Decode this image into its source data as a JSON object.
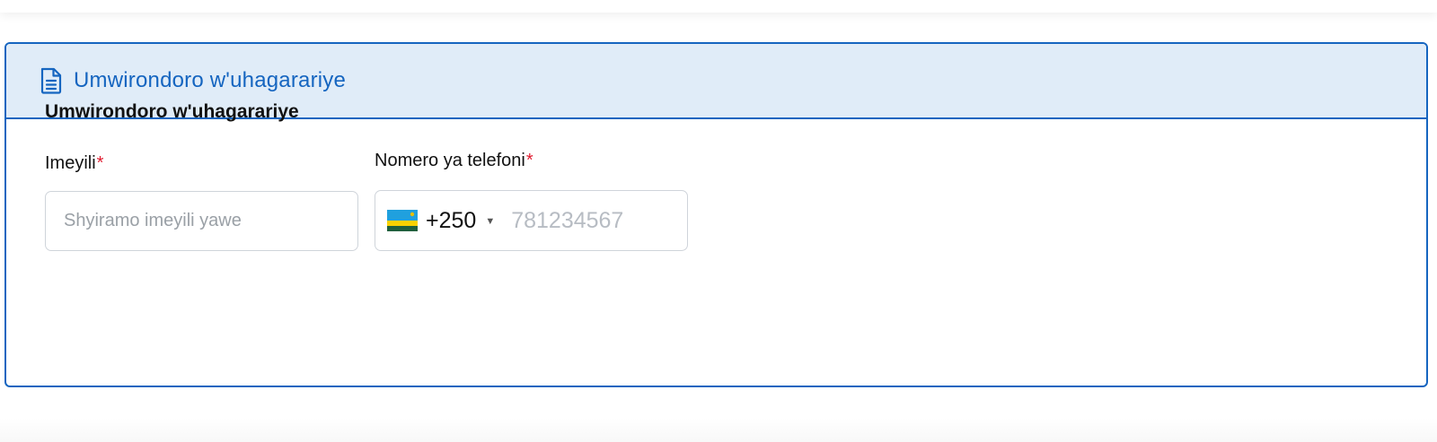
{
  "card": {
    "header_title": "Umwirondoro w'uhagarariye",
    "header_icon": "document-icon",
    "section_title": "Umwirondoro w'uhagarariye"
  },
  "email": {
    "label": "Imeyili",
    "required_mark": "*",
    "value": "",
    "placeholder": "Shyiramo imeyili yawe"
  },
  "phone": {
    "label": "Nomero ya telefoni",
    "required_mark": "*",
    "country_flag": "rwanda-flag-icon",
    "dial_code": "+250",
    "value": "",
    "placeholder": "781234567"
  },
  "colors": {
    "accent": "#1565c0",
    "header_bg": "#e0ecf8",
    "required": "#e01b2f",
    "input_border": "#cfd4da",
    "placeholder": "#9aa0a6"
  }
}
